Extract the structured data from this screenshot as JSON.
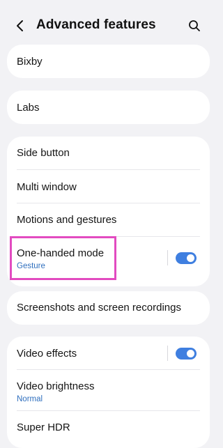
{
  "header": {
    "back_icon": "chevron-left-icon",
    "title": "Advanced features",
    "search_icon": "search-icon"
  },
  "cards": {
    "bixby": {
      "label": "Bixby"
    },
    "labs": {
      "label": "Labs"
    },
    "group1": {
      "side_button": "Side button",
      "multi_window": "Multi window",
      "motions": "Motions and gestures",
      "one_handed": {
        "label": "One-handed mode",
        "sub": "Gesture",
        "enabled": true
      }
    },
    "screenshots": {
      "label": "Screenshots and screen recordings"
    },
    "group2": {
      "video_effects": {
        "label": "Video effects",
        "enabled": true
      },
      "video_brightness": {
        "label": "Video brightness",
        "sub": "Normal"
      },
      "super_hdr": {
        "label": "Super HDR"
      }
    }
  },
  "colors": {
    "accent": "#3f7fe0",
    "sub_text": "#2f6fbe",
    "highlight": "#e24bc0",
    "background": "#f2f2f5"
  }
}
